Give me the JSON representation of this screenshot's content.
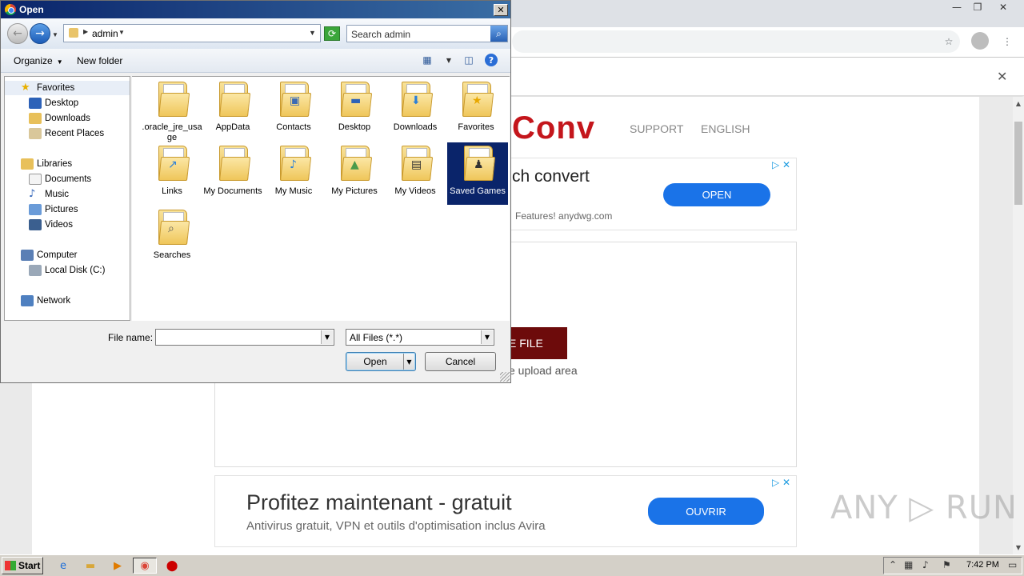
{
  "browser": {
    "window_controls": [
      "—",
      "❐",
      "✕"
    ],
    "star_icon": "star-icon",
    "menu_icon": "⋮",
    "infobar_close": "✕"
  },
  "webpage": {
    "logo_text": "Conv",
    "nav_support": "SUPPORT",
    "nav_english": "ENGLISH",
    "ad1": {
      "title": "ch convert",
      "subtitle": "Features! anydwg.com",
      "button": "OPEN"
    },
    "choose_file_button": "E FILE",
    "upload_hint": "e upload area",
    "ad2": {
      "title": "Profitez maintenant - gratuit",
      "subtitle": "Antivirus gratuit, VPN et outils d'optimisation inclus Avira",
      "button": "OUVRIR"
    },
    "watermark": "ANY ▷ RUN"
  },
  "dialog": {
    "title": "Open",
    "address": "admin",
    "search_placeholder": "Search admin",
    "toolbar": {
      "organize": "Organize",
      "new_folder": "New folder"
    },
    "nav_pane": {
      "favorites": "Favorites",
      "desktop": "Desktop",
      "downloads": "Downloads",
      "recent_places": "Recent Places",
      "libraries": "Libraries",
      "documents": "Documents",
      "music": "Music",
      "pictures": "Pictures",
      "videos": "Videos",
      "computer": "Computer",
      "local_disk": "Local Disk (C:)",
      "network": "Network"
    },
    "files": [
      ".oracle_jre_usage",
      "AppData",
      "Contacts",
      "Desktop",
      "Downloads",
      "Favorites",
      "Links",
      "My Documents",
      "My Music",
      "My Pictures",
      "My Videos",
      "Saved Games",
      "Searches"
    ],
    "selected_file": "Saved Games",
    "file_name_label": "File name:",
    "file_name_value": "",
    "file_type": "All Files (*.*)",
    "open_button": "Open",
    "cancel_button": "Cancel"
  },
  "taskbar": {
    "start": "Start",
    "clock": "7:42 PM"
  },
  "colors": {
    "title_bar": "#0a246a",
    "selection": "#0a246a",
    "logo_red": "#c4161c",
    "ad_button": "#1a73e8",
    "upload_button": "#6d0b0b"
  }
}
